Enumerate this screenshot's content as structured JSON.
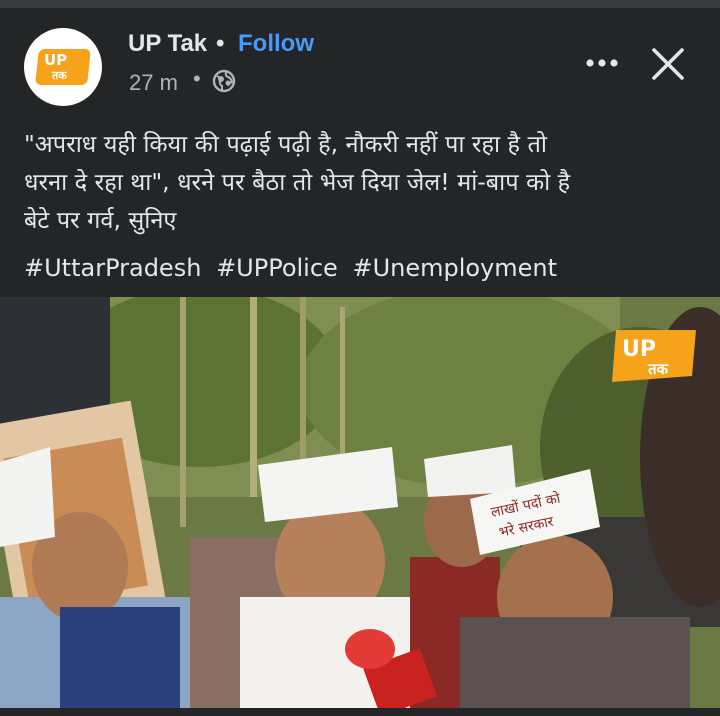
{
  "post": {
    "page_name": "UP Tak",
    "separator": "•",
    "follow_label": "Follow",
    "time": "27 m",
    "time_separator": "•",
    "audience_icon": "globe-icon",
    "caption_lines": [
      "\"अपराध यही किया की पढ़ाई पढ़ी है, नौकरी नहीं पा रहा है तो",
      "धरना दे रहा था\", धरने पर बैठा तो भेज दिया जेल! मां-बाप को है",
      "बेटे पर गर्व, सुनिए"
    ],
    "hashtags": [
      "#UttarPradesh",
      "#UPPolice",
      "#Unemployment"
    ],
    "more_icon": "more-dots-icon",
    "close_icon": "close-icon"
  },
  "logo": {
    "line1": "UP",
    "line2": "तक"
  },
  "video": {
    "watermark_line1": "UP",
    "watermark_line2": "तक",
    "cap_text_1": "लाखों पदों को",
    "cap_text_2": "भरे सरकार"
  },
  "colors": {
    "background": "#242526",
    "accent": "#4599ff",
    "brand": "#f7a21b"
  }
}
